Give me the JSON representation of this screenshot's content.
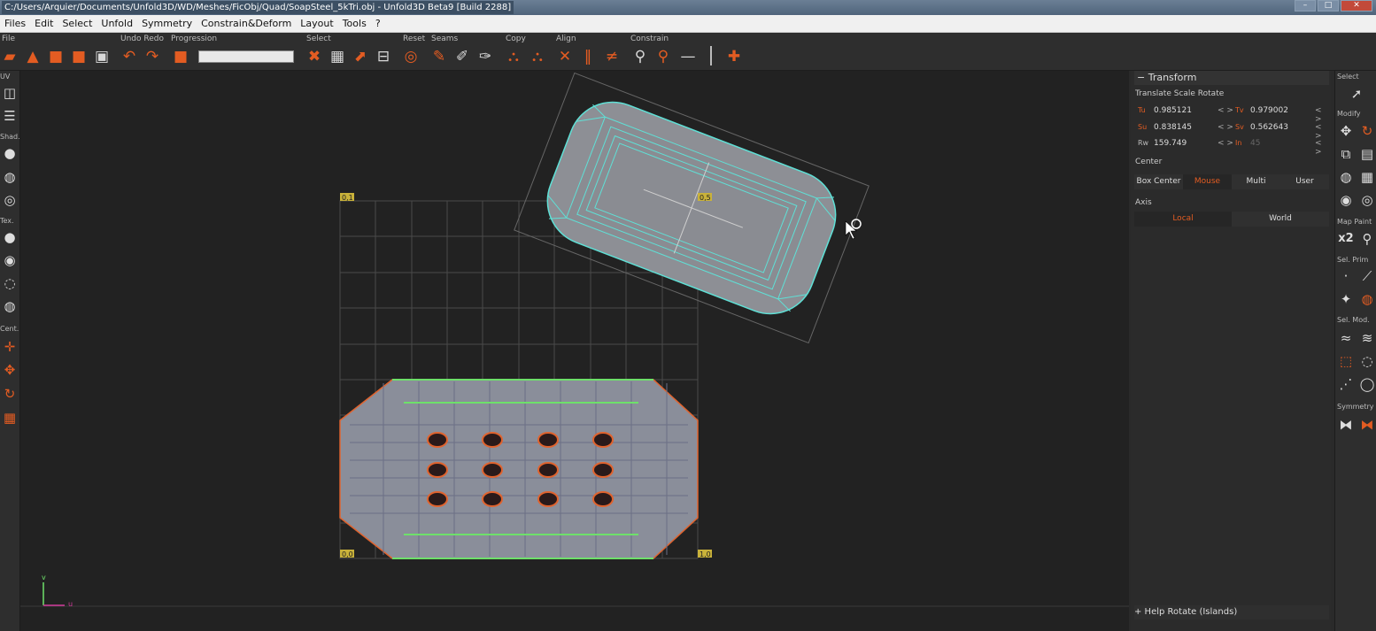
{
  "window": {
    "title": "C:/Users/Arquier/Documents/Unfold3D/WD/Meshes/FicObj/Quad/SoapSteel_5kTri.obj - Unfold3D Beta9 [Build 2288]"
  },
  "menu": [
    "Files",
    "Edit",
    "Select",
    "Unfold",
    "Symmetry",
    "Constrain&Deform",
    "Layout",
    "Tools",
    "?"
  ],
  "toolbar": {
    "groups": {
      "file": "File",
      "undo_redo": "Undo Redo",
      "progression": "Progression",
      "select": "Select",
      "reset": "Reset",
      "seams": "Seams",
      "copy": "Copy",
      "align": "Align",
      "constrain": "Constrain"
    }
  },
  "left_toolbar": {
    "uv": "UV",
    "shad": "Shad.",
    "tex": "Tex.",
    "cent": "Cent."
  },
  "viewport": {
    "corner_labels": {
      "top_left": "0,1",
      "bottom_left": "0,0",
      "bottom_right": "1,0",
      "pivot": "0,5"
    },
    "axis": {
      "v": "v",
      "u": "u"
    }
  },
  "transform_panel": {
    "title": "Transform",
    "subtitle": "Translate Scale Rotate",
    "fields": {
      "tu": {
        "label": "Tu",
        "value": "0.985121"
      },
      "tv": {
        "label": "Tv",
        "value": "0.979002"
      },
      "su": {
        "label": "Su",
        "value": "0.838145"
      },
      "sv": {
        "label": "Sv",
        "value": "0.562643"
      },
      "rw": {
        "label": "Rw",
        "value": "159.749"
      },
      "in": {
        "label": "In",
        "value": "45"
      }
    },
    "arrows": "< >",
    "center": {
      "label": "Center",
      "options": [
        "Box Center",
        "Mouse",
        "Multi",
        "User"
      ],
      "selected": "Mouse"
    },
    "axis": {
      "label": "Axis",
      "options": [
        "Local",
        "World"
      ],
      "selected": "Local"
    },
    "help": "+ Help Rotate (Islands)"
  },
  "right_toolbar": {
    "select": "Select",
    "modify": "Modify",
    "map_paint": "Map Paint",
    "sel_prim": "Sel. Prim",
    "sel_mod": "Sel. Mod.",
    "symmetry": "Symmetry",
    "x2": "x2"
  },
  "colors": {
    "accent": "#e35c22",
    "uv_cyan": "#5fe0d6",
    "seam_green": "#6ee06a",
    "mesh_fill": "#8a8e9a"
  }
}
